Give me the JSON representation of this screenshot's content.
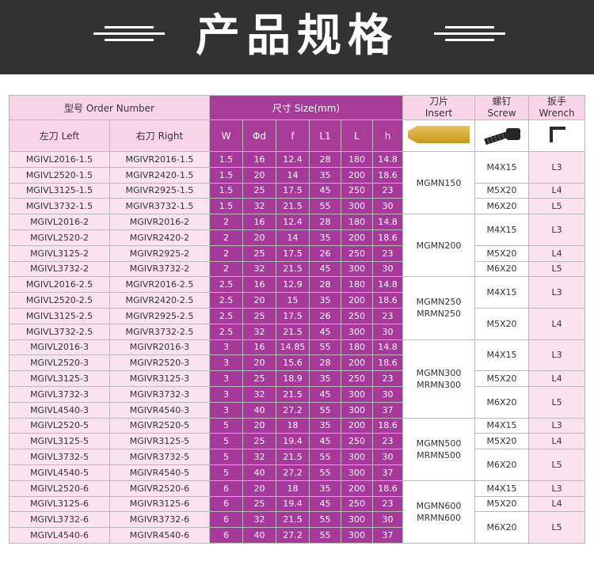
{
  "banner": {
    "title": "产品规格"
  },
  "table": {
    "headers": {
      "model": "型号 Order Number",
      "left": "左刀 Left",
      "right": "右刀 Right",
      "size": "尺寸 Size(mm)",
      "w": "W",
      "phid": "Φd",
      "f": "f",
      "l1": "L1",
      "l": "L",
      "h": "h",
      "insert_cn": "刀片",
      "insert_en": "Insert",
      "screw_cn": "螺钉",
      "screw_en": "Screw",
      "wrench_cn": "扳手",
      "wrench_en": "Wrench"
    },
    "rows": [
      [
        "MGIVL2016-1.5",
        "MGIVR2016-1.5",
        "1.5",
        "16",
        "12.4",
        "28",
        "180",
        "14.8"
      ],
      [
        "MGIVL2520-1.5",
        "MGIVR2420-1.5",
        "1.5",
        "20",
        "14",
        "35",
        "200",
        "18.6"
      ],
      [
        "MGIVL3125-1.5",
        "MGIVR2925-1.5",
        "1.5",
        "25",
        "17.5",
        "45",
        "250",
        "23"
      ],
      [
        "MGIVL3732-1.5",
        "MGIVR3732-1.5",
        "1.5",
        "32",
        "21.5",
        "55",
        "300",
        "30"
      ],
      [
        "MGIVL2016-2",
        "MGIVR2016-2",
        "2",
        "16",
        "12.4",
        "28",
        "180",
        "14.8"
      ],
      [
        "MGIVL2520-2",
        "MGIVR2420-2",
        "2",
        "20",
        "14",
        "35",
        "200",
        "18.6"
      ],
      [
        "MGIVL3125-2",
        "MGIVR2925-2",
        "2",
        "25",
        "17.5",
        "26",
        "250",
        "23"
      ],
      [
        "MGIVL3732-2",
        "MGIVR3732-2",
        "2",
        "32",
        "21.5",
        "45",
        "300",
        "30"
      ],
      [
        "MGIVL2016-2.5",
        "MGIVR2016-2.5",
        "2.5",
        "16",
        "12.9",
        "28",
        "180",
        "14.8"
      ],
      [
        "MGIVL2520-2.5",
        "MGIVR2420-2.5",
        "2.5",
        "20",
        "15",
        "35",
        "200",
        "18.6"
      ],
      [
        "MGIVL3125-2.5",
        "MGIVR2925-2.5",
        "2.5",
        "25",
        "17.5",
        "26",
        "250",
        "23"
      ],
      [
        "MGIVL3732-2.5",
        "MGIVR3732-2.5",
        "2.5",
        "32",
        "21.5",
        "45",
        "300",
        "30"
      ],
      [
        "MGIVL2016-3",
        "MGIVR2016-3",
        "3",
        "16",
        "14.85",
        "55",
        "180",
        "14.8"
      ],
      [
        "MGIVL2520-3",
        "MGIVR2520-3",
        "3",
        "20",
        "15.6",
        "28",
        "200",
        "18.6"
      ],
      [
        "MGIVL3125-3",
        "MGIVR3125-3",
        "3",
        "25",
        "18.9",
        "35",
        "250",
        "23"
      ],
      [
        "MGIVL3732-3",
        "MGIVR3732-3",
        "3",
        "32",
        "21.5",
        "45",
        "300",
        "30"
      ],
      [
        "MGIVL4540-3",
        "MGIVR4540-3",
        "3",
        "40",
        "27.2",
        "55",
        "300",
        "37"
      ],
      [
        "MGIVL2520-5",
        "MGIVR2520-5",
        "5",
        "20",
        "18",
        "35",
        "200",
        "18.6"
      ],
      [
        "MGIVL3125-5",
        "MGIVR3125-5",
        "5",
        "25",
        "19.4",
        "45",
        "250",
        "23"
      ],
      [
        "MGIVL3732-5",
        "MGIVR3732-5",
        "5",
        "32",
        "21.5",
        "55",
        "300",
        "30"
      ],
      [
        "MGIVL4540-5",
        "MGIVR4540-5",
        "5",
        "40",
        "27.2",
        "55",
        "300",
        "37"
      ],
      [
        "MGIVL2520-6",
        "MGIVR2520-6",
        "6",
        "20",
        "18",
        "35",
        "200",
        "18.6"
      ],
      [
        "MGIVL3125-6",
        "MGIVR3125-6",
        "6",
        "25",
        "19.4",
        "45",
        "250",
        "23"
      ],
      [
        "MGIVL3732-6",
        "MGIVR3732-6",
        "6",
        "32",
        "21.5",
        "55",
        "300",
        "30"
      ],
      [
        "MGIVL4540-6",
        "MGIVR4540-6",
        "6",
        "40",
        "27.2",
        "55",
        "300",
        "37"
      ]
    ],
    "inserts": [
      {
        "text": "MGMN150",
        "start": 0,
        "span": 4
      },
      {
        "text": "MGMN200",
        "start": 4,
        "span": 4
      },
      {
        "text": "MGMN250\nMRMN250",
        "start": 8,
        "span": 4
      },
      {
        "text": "MGMN300\nMRMN300",
        "start": 12,
        "span": 5
      },
      {
        "text": "MGMN500\nMRMN500",
        "start": 17,
        "span": 4
      },
      {
        "text": "MGMN600\nMRMN600",
        "start": 21,
        "span": 4
      }
    ],
    "screws": [
      {
        "text": "M4X15",
        "start": 0,
        "span": 2
      },
      {
        "text": "M5X20",
        "start": 2,
        "span": 1
      },
      {
        "text": "M6X20",
        "start": 3,
        "span": 1
      },
      {
        "text": "M4X15",
        "start": 4,
        "span": 2
      },
      {
        "text": "M5X20",
        "start": 6,
        "span": 1
      },
      {
        "text": "M6X20",
        "start": 7,
        "span": 1
      },
      {
        "text": "M4X15",
        "start": 8,
        "span": 2
      },
      {
        "text": "M5X20",
        "start": 10,
        "span": 2
      },
      {
        "text": "M4X15",
        "start": 12,
        "span": 2
      },
      {
        "text": "M5X20",
        "start": 14,
        "span": 1
      },
      {
        "text": "M6X20",
        "start": 15,
        "span": 2
      },
      {
        "text": "M4X15",
        "start": 17,
        "span": 1
      },
      {
        "text": "M5X20",
        "start": 18,
        "span": 1
      },
      {
        "text": "M6X20",
        "start": 19,
        "span": 2
      },
      {
        "text": "M4X15",
        "start": 21,
        "span": 1
      },
      {
        "text": "M5X20",
        "start": 22,
        "span": 1
      },
      {
        "text": "M6X20",
        "start": 23,
        "span": 2
      }
    ],
    "wrenches": [
      {
        "text": "L3",
        "start": 0,
        "span": 2
      },
      {
        "text": "L4",
        "start": 2,
        "span": 1
      },
      {
        "text": "L5",
        "start": 3,
        "span": 1
      },
      {
        "text": "L3",
        "start": 4,
        "span": 2
      },
      {
        "text": "L4",
        "start": 6,
        "span": 1
      },
      {
        "text": "L5",
        "start": 7,
        "span": 1
      },
      {
        "text": "L3",
        "start": 8,
        "span": 2
      },
      {
        "text": "L4",
        "start": 10,
        "span": 2
      },
      {
        "text": "L3",
        "start": 12,
        "span": 2
      },
      {
        "text": "L4",
        "start": 14,
        "span": 1
      },
      {
        "text": "L5",
        "start": 15,
        "span": 2
      },
      {
        "text": "L3",
        "start": 17,
        "span": 1
      },
      {
        "text": "L4",
        "start": 18,
        "span": 1
      },
      {
        "text": "L5",
        "start": 19,
        "span": 2
      },
      {
        "text": "L3",
        "start": 21,
        "span": 1
      },
      {
        "text": "L4",
        "start": 22,
        "span": 1
      },
      {
        "text": "L5",
        "start": 23,
        "span": 2
      }
    ],
    "colors": {
      "banner_bg": "#323232",
      "pink_header": "#fad5e8",
      "purple_header": "#a83a98",
      "pink_cell": "#fbe2ef",
      "purple_cell": "#a7399a",
      "border": "#b9b9b9"
    }
  }
}
